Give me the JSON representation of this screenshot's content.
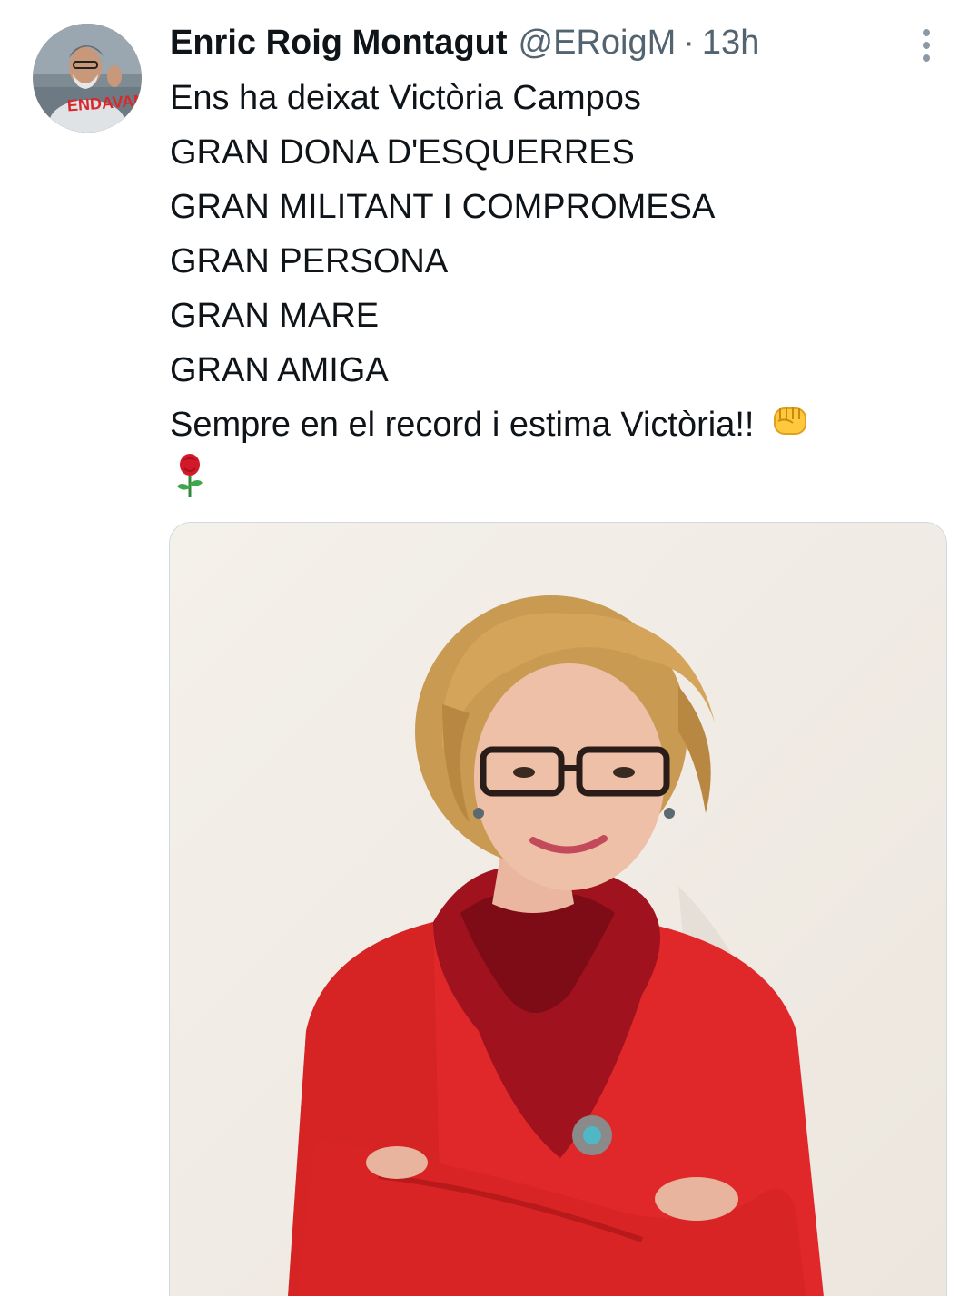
{
  "tweet": {
    "author_name": "Enric Roig Montagut",
    "handle": "@ERoigM",
    "separator": "·",
    "time": "13h",
    "avatar_caption": "ENDAVANT",
    "lines": [
      "Ens ha deixat Victòria Campos",
      "GRAN DONA D'ESQUERRES",
      "GRAN MILITANT I COMPROMESA",
      "GRAN PERSONA",
      "GRAN MARE",
      "GRAN AMIGA",
      "Sempre en el record i estima Victòria!!"
    ],
    "icons": {
      "more": "more-vertical-icon",
      "fist": "raised-fist-emoji",
      "rose": "rose-emoji"
    }
  },
  "colors": {
    "text": "#0f1419",
    "secondary": "#536471",
    "border": "#cfd9de",
    "sweater_red": "#e0282a",
    "scarf_red": "#a0121e"
  }
}
